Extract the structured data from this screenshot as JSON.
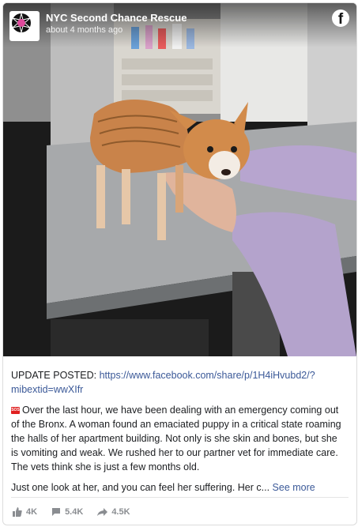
{
  "post": {
    "page_name": "NYC Second Chance Rescue",
    "time": "about 4 months ago",
    "image_alt": "Emaciated puppy on vet exam table"
  },
  "caption": {
    "update_prefix": "UPDATE POSTED:",
    "update_link": "https://www.facebook.com/share/p/1H4iHvubd2/?mibextid=wwXIfr",
    "paragraph1": "Over the last hour, we have been dealing with an emergency coming out of the Bronx. A woman found an emaciated puppy in a critical state roaming the halls of her apartment building. Not only is she skin and bones, but she is vomiting and weak. We rushed her to our partner vet for immediate care. The vets think she is just a few months old.",
    "paragraph2": "Just one look at her, and you can feel her suffering. Her c...",
    "see_more": "See more",
    "sos_label": "SOS"
  },
  "stats": {
    "likes": "4K",
    "comments": "5.4K",
    "shares": "4.5K"
  },
  "colors": {
    "link": "#3b5998",
    "muted": "#8a8d91"
  }
}
